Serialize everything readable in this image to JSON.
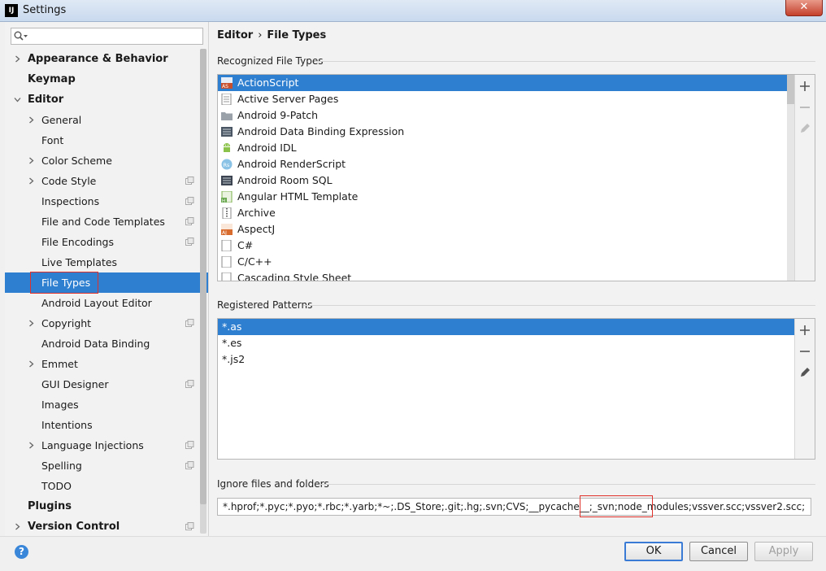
{
  "window": {
    "title": "Settings",
    "app_icon": "IJ"
  },
  "search": {
    "placeholder": ""
  },
  "sidebar": {
    "items": [
      {
        "label": "Appearance & Behavior",
        "level": 0,
        "chevron": "right",
        "project": false
      },
      {
        "label": "Keymap",
        "level": 0,
        "chevron": "none",
        "project": false
      },
      {
        "label": "Editor",
        "level": 0,
        "chevron": "down",
        "project": false
      },
      {
        "label": "General",
        "level": 1,
        "chevron": "right",
        "project": false
      },
      {
        "label": "Font",
        "level": 1,
        "chevron": "none",
        "project": false
      },
      {
        "label": "Color Scheme",
        "level": 1,
        "chevron": "right",
        "project": false
      },
      {
        "label": "Code Style",
        "level": 1,
        "chevron": "right",
        "project": true
      },
      {
        "label": "Inspections",
        "level": 1,
        "chevron": "none",
        "project": true
      },
      {
        "label": "File and Code Templates",
        "level": 1,
        "chevron": "none",
        "project": true
      },
      {
        "label": "File Encodings",
        "level": 1,
        "chevron": "none",
        "project": true
      },
      {
        "label": "Live Templates",
        "level": 1,
        "chevron": "none",
        "project": false
      },
      {
        "label": "File Types",
        "level": 1,
        "chevron": "none",
        "project": false,
        "selected": true
      },
      {
        "label": "Android Layout Editor",
        "level": 1,
        "chevron": "none",
        "project": false
      },
      {
        "label": "Copyright",
        "level": 1,
        "chevron": "right",
        "project": true
      },
      {
        "label": "Android Data Binding",
        "level": 1,
        "chevron": "none",
        "project": false
      },
      {
        "label": "Emmet",
        "level": 1,
        "chevron": "right",
        "project": false
      },
      {
        "label": "GUI Designer",
        "level": 1,
        "chevron": "none",
        "project": true
      },
      {
        "label": "Images",
        "level": 1,
        "chevron": "none",
        "project": false
      },
      {
        "label": "Intentions",
        "level": 1,
        "chevron": "none",
        "project": false
      },
      {
        "label": "Language Injections",
        "level": 1,
        "chevron": "right",
        "project": true
      },
      {
        "label": "Spelling",
        "level": 1,
        "chevron": "none",
        "project": true
      },
      {
        "label": "TODO",
        "level": 1,
        "chevron": "none",
        "project": false
      },
      {
        "label": "Plugins",
        "level": 0,
        "chevron": "none",
        "project": false
      },
      {
        "label": "Version Control",
        "level": 0,
        "chevron": "right",
        "project": true
      }
    ]
  },
  "breadcrumb": {
    "parent": "Editor",
    "separator": "›",
    "current": "File Types"
  },
  "recognized": {
    "title": "Recognized File Types",
    "items": [
      {
        "label": "ActionScript",
        "icon": "actionscript-icon",
        "selected": true
      },
      {
        "label": "Active Server Pages",
        "icon": "asp-icon"
      },
      {
        "label": "Android 9-Patch",
        "icon": "folder-icon"
      },
      {
        "label": "Android Data Binding Expression",
        "icon": "binding-icon"
      },
      {
        "label": "Android IDL",
        "icon": "android-icon"
      },
      {
        "label": "Android RenderScript",
        "icon": "renderscript-icon"
      },
      {
        "label": "Android Room SQL",
        "icon": "sql-icon"
      },
      {
        "label": "Angular HTML Template",
        "icon": "html-icon"
      },
      {
        "label": "Archive",
        "icon": "archive-icon"
      },
      {
        "label": "AspectJ",
        "icon": "aspectj-icon"
      },
      {
        "label": "C#",
        "icon": "csharp-icon"
      },
      {
        "label": "C/C++",
        "icon": "cpp-icon"
      },
      {
        "label": "Cascading Style Sheet",
        "icon": "css-icon"
      }
    ]
  },
  "patterns": {
    "title": "Registered Patterns",
    "items": [
      {
        "label": "*.as",
        "selected": true
      },
      {
        "label": "*.es"
      },
      {
        "label": "*.js2"
      }
    ]
  },
  "ignore": {
    "title": "Ignore files and folders",
    "value": "*.hprof;*.pyc;*.pyo;*.rbc;*.yarb;*~;.DS_Store;.git;.hg;.svn;CVS;__pycache__;_svn;node_modules;vssver.scc;vssver2.scc;"
  },
  "buttons": {
    "ok": "OK",
    "cancel": "Cancel",
    "apply": "Apply",
    "help": "?"
  },
  "colors": {
    "selection": "#2f7fd0",
    "highlight_box": "#e0302a",
    "default_button": "#3a7bd5"
  }
}
